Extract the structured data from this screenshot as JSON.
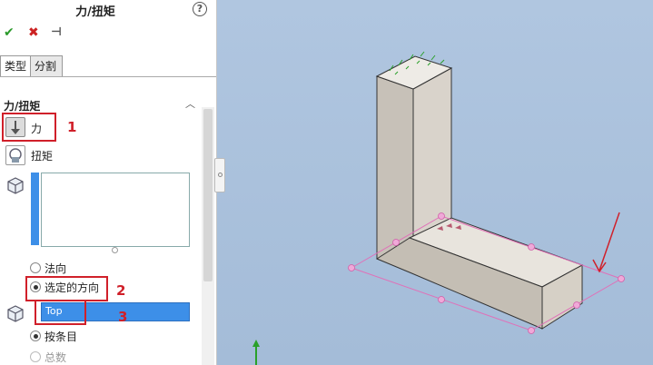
{
  "panel": {
    "title": "力/扭矩",
    "help": "?",
    "tabs": [
      "类型",
      "分割"
    ],
    "section_title": "力/扭矩",
    "force_label": "力",
    "torque_label": "扭矩",
    "radio_normal": "法向",
    "radio_selected_dir": "选定的方向",
    "direction_value": "Top",
    "radio_per_item": "按条目",
    "radio_total": "总数"
  },
  "annotations": [
    "1",
    "2",
    "3"
  ],
  "colors": {
    "accent_blue": "#3d8fe8",
    "annotation_red": "#d0202a",
    "viewport_bg": "#a8c0dc"
  }
}
